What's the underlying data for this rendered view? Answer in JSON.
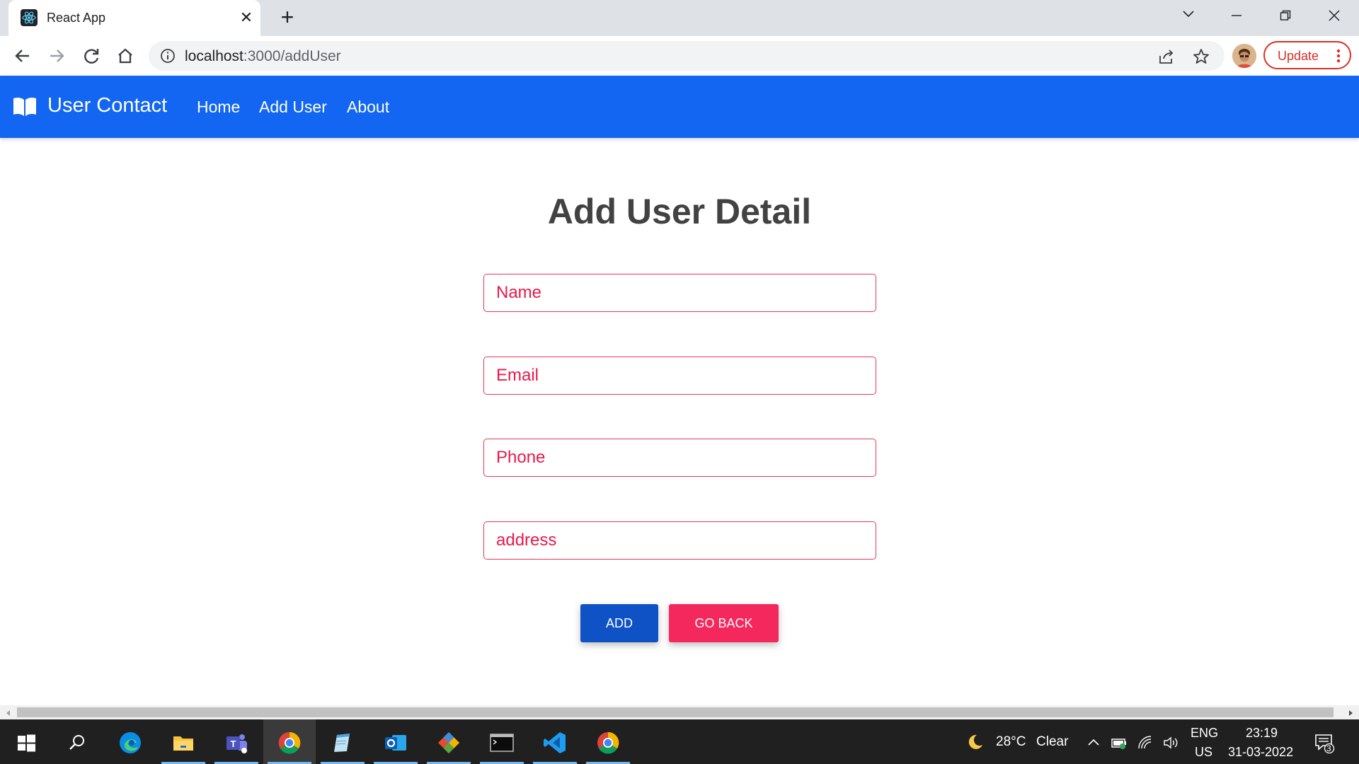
{
  "browser": {
    "tab": {
      "title": "React App",
      "favicon": "react-icon"
    },
    "url": {
      "host": "localhost",
      "path": ":3000/addUser"
    },
    "update_label": "Update"
  },
  "navbar": {
    "brand": "User Contact",
    "brand_icon": "book-open-icon",
    "links": [
      "Home",
      "Add User",
      "About"
    ],
    "color": "#1266f1"
  },
  "form": {
    "title": "Add User Detail",
    "fields": [
      {
        "placeholder": "Name",
        "value": ""
      },
      {
        "placeholder": "Email",
        "value": ""
      },
      {
        "placeholder": "Phone",
        "value": ""
      },
      {
        "placeholder": "address",
        "value": ""
      }
    ],
    "add_label": "ADD",
    "back_label": "GO BACK",
    "accent": "#e8194c",
    "add_color": "#0f52c6",
    "back_color": "#f4285c"
  },
  "taskbar": {
    "weather": {
      "temp": "28°C",
      "condition": "Clear"
    },
    "language": {
      "top": "ENG",
      "bottom": "US"
    },
    "time": "23:19",
    "date": "31-03-2022",
    "notifications": "3",
    "apps": [
      "windows-start",
      "search",
      "edge",
      "file-explorer",
      "teams",
      "chrome",
      "notepad",
      "outlook",
      "git",
      "terminal",
      "vscode",
      "chrome-2"
    ]
  }
}
